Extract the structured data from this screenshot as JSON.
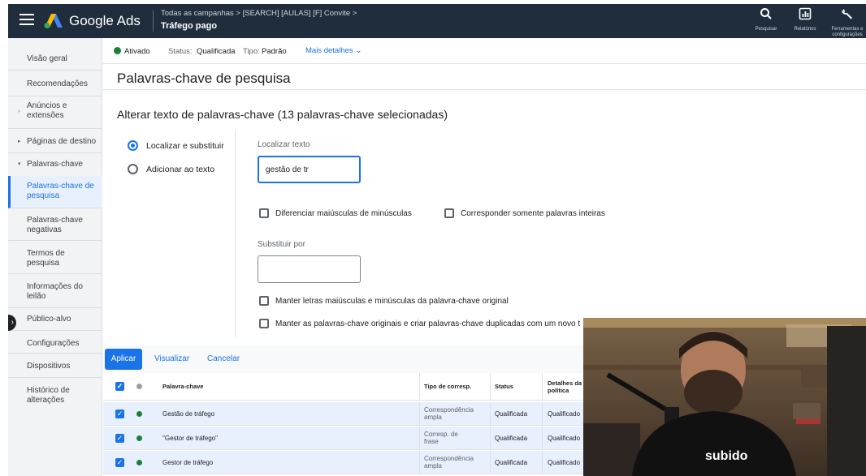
{
  "topbar": {
    "brand": "Google Ads",
    "breadcrumb": "Todas as campanhas  >  [SEARCH] [AULAS] [F] Convite  >",
    "title": "Tráfego pago",
    "actions": [
      {
        "label": "Pesquisar",
        "icon": "search-icon"
      },
      {
        "label": "Relatórios",
        "icon": "reports-icon"
      },
      {
        "label_1": "Ferramentas e",
        "label_2": "configurações",
        "icon": "wrench-icon"
      }
    ]
  },
  "sidebar": {
    "items": [
      {
        "line1": "Visão geral"
      },
      {
        "line1": "Recomendações"
      },
      {
        "line1": "Anúncios e",
        "line2": "extensões"
      },
      {
        "line1": "Páginas de destino"
      },
      {
        "line1": "Palavras-chave"
      },
      {
        "line1": "Palavras-chave de",
        "line2": "pesquisa"
      },
      {
        "line1": "Palavras-chave",
        "line2": "negativas"
      },
      {
        "line1": "Termos de",
        "line2": "pesquisa"
      },
      {
        "line1": "Informações do",
        "line2": "leilão"
      },
      {
        "line1": "Público-alvo"
      },
      {
        "line1": "Configurações"
      },
      {
        "line1": "Dispositivos"
      },
      {
        "line1": "Histórico de",
        "line2": "alterações"
      }
    ]
  },
  "status": {
    "enabled": "Ativado",
    "status_label": "Status:",
    "status_value": "Qualificada",
    "type_label": "Tipo:",
    "type_value": "Padrão",
    "more": "Mais detalhes"
  },
  "page": {
    "title": "Palavras-chave de pesquisa"
  },
  "edit": {
    "title": "Alterar texto de palavras-chave (13 palavras-chave selecionadas)",
    "option_find_replace": "Localizar e substituir",
    "option_append": "Adicionar ao texto",
    "find_label": "Localizar texto",
    "find_value": "gestão de tr",
    "match_case": "Diferenciar maiúsculas de minúsculas",
    "whole_words": "Corresponder somente palavras inteiras",
    "replace_label": "Substituir por",
    "replace_value": "",
    "keep_case": "Manter letras maiúsculas e minúsculas da palavra-chave original",
    "keep_originals": "Manter as palavras-chave originais e criar palavras-chave duplicadas com um novo t"
  },
  "buttons": {
    "apply": "Aplicar",
    "preview": "Visualizar",
    "cancel": "Cancelar"
  },
  "table": {
    "headers": {
      "keyword": "Palavra-chave",
      "match_type": "Tipo de corresp.",
      "status": "Status",
      "policy_1": "Detalhes da",
      "policy_2": "política"
    },
    "rows": [
      {
        "keyword": "Gestão de tráfego",
        "match_1": "Correspondência",
        "match_2": "ampla",
        "status": "Qualificada",
        "policy": "Qualificado"
      },
      {
        "keyword": "\"Gestor de tráfego\"",
        "match_1": "Corresp. de",
        "match_2": "frase",
        "status": "Qualificada",
        "policy": "Qualificado"
      },
      {
        "keyword": "Gestor de tráfego",
        "match_1": "Correspondência",
        "match_2": "ampla",
        "status": "Qualificada",
        "policy": "Qualificado"
      }
    ]
  },
  "webcam": {
    "shirt_text": "subido"
  }
}
